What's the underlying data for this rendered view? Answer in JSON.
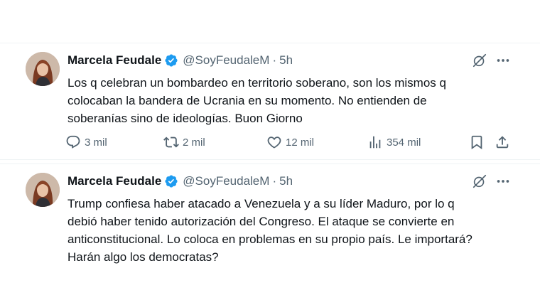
{
  "colors": {
    "text": "#0f1419",
    "secondary": "#536471",
    "verified": "#1d9bf0",
    "border": "#eff3f4"
  },
  "tweets": [
    {
      "author": {
        "name": "Marcela Feudale",
        "handle": "@SoyFeudaleM"
      },
      "separator": "·",
      "time": "5h",
      "text": "Los q celebran un bombardeo en territorio soberano, son los mismos q\ncolocaban la bandera de Ucrania en su momento. No entienden de\nsoberanías sino de ideologías. Buon Giorno",
      "stats": {
        "replies": "3 mil",
        "reposts": "2 mil",
        "likes": "12 mil",
        "views": "354 mil"
      }
    },
    {
      "author": {
        "name": "Marcela Feudale",
        "handle": "@SoyFeudaleM"
      },
      "separator": "·",
      "time": "5h",
      "text": "Trump confiesa haber atacado a Venezuela y a su líder Maduro, por lo q\ndebió haber tenido autorización del Congreso. El ataque se convierte en\nanticonstitucional. Lo coloca en problemas en su propio país. Le importará?\nHarán algo los democratas?"
    }
  ],
  "icons": [
    "verified-badge-icon",
    "grok-icon",
    "more-icon",
    "reply-icon",
    "repost-icon",
    "like-icon",
    "views-icon",
    "bookmark-icon",
    "share-icon"
  ]
}
